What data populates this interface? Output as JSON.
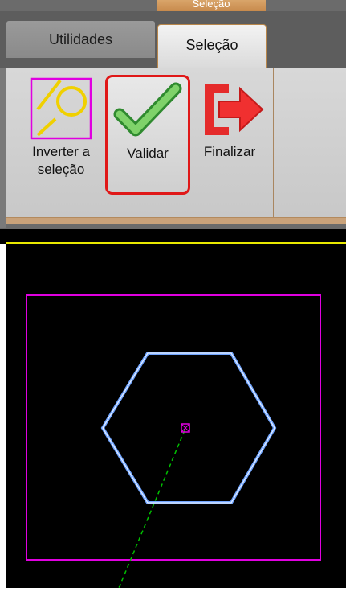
{
  "ribbon": {
    "context_label": "Seleção",
    "tabs": [
      {
        "label": "Utilidades",
        "active": false
      },
      {
        "label": "Seleção",
        "active": true
      }
    ],
    "buttons": {
      "invert_line1": "Inverter a",
      "invert_line2": "seleção",
      "validate": "Validar",
      "finish": "Finalizar"
    }
  },
  "colors": {
    "highlight_border": "#e01818",
    "selection_rect": "#e000e0",
    "hexagon": "#7fb0ff",
    "guide_line": "#00c000",
    "top_line": "#e8e800"
  },
  "icons": {
    "invert": "invert-selection-icon",
    "validate": "checkmark-icon",
    "finish": "exit-arrow-icon"
  }
}
